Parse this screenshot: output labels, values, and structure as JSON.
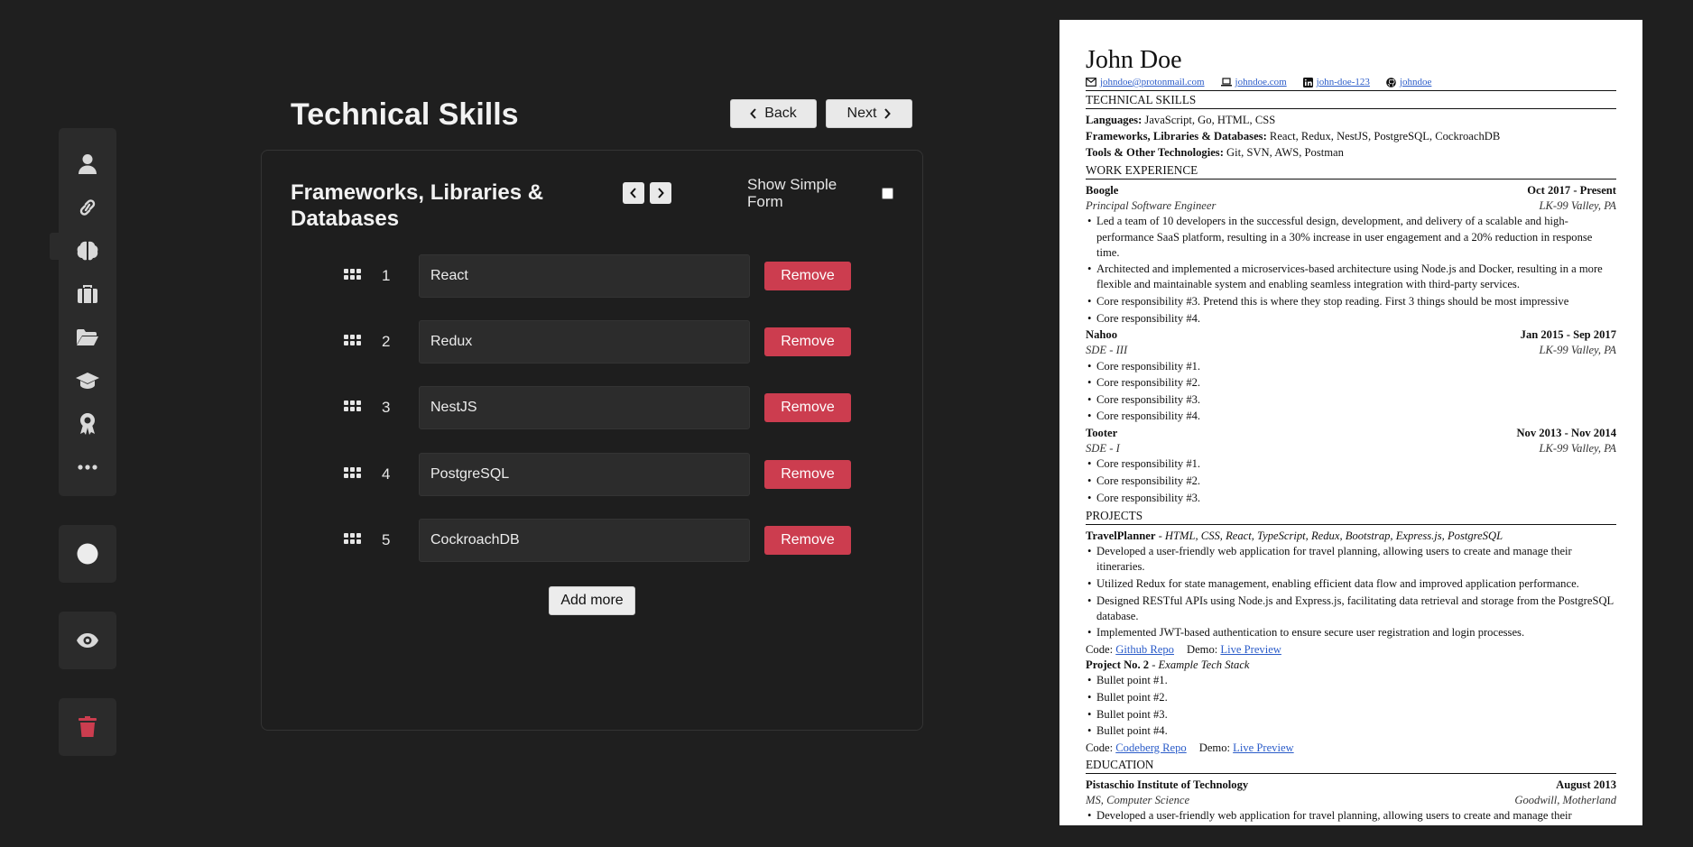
{
  "sidebar": {
    "nav_icons": [
      "user-icon",
      "link-icon",
      "brain-icon",
      "briefcase-icon",
      "folder-icon",
      "graduation-cap-icon",
      "award-icon",
      "ellipsis-icon"
    ],
    "active_index": 2,
    "extra_icons": [
      "circle-icon",
      "eye-icon",
      "trash-icon"
    ],
    "trash_color": "#cc3d4f"
  },
  "header": {
    "title": "Technical Skills",
    "back_label": "Back",
    "next_label": "Next"
  },
  "card": {
    "title": "Frameworks, Libraries & Databases",
    "show_simple_label": "Show Simple Form",
    "show_simple_checked": false,
    "items": [
      {
        "num": "1",
        "value": "React"
      },
      {
        "num": "2",
        "value": "Redux"
      },
      {
        "num": "3",
        "value": "NestJS"
      },
      {
        "num": "4",
        "value": "PostgreSQL"
      },
      {
        "num": "5",
        "value": "CockroachDB"
      }
    ],
    "remove_label": "Remove",
    "add_more_label": "Add more",
    "accent_color": "#cc3d4f"
  },
  "resume": {
    "name": "John Doe",
    "contacts": [
      {
        "icon": "mail-icon",
        "text": "johndoe@protonmail.com"
      },
      {
        "icon": "laptop-icon",
        "text": "johndoe.com"
      },
      {
        "icon": "linkedin-icon",
        "text": "john-doe-123"
      },
      {
        "icon": "github-icon",
        "text": "johndoe"
      }
    ],
    "skills_heading": "TECHNICAL SKILLS",
    "skills": [
      {
        "label": "Languages:",
        "value": " JavaScript, Go, HTML, CSS"
      },
      {
        "label": "Frameworks, Libraries & Databases:",
        "value": " React, Redux, NestJS, PostgreSQL, CockroachDB"
      },
      {
        "label": "Tools & Other Technologies:",
        "value": " Git, SVN, AWS, Postman"
      }
    ],
    "work_heading": "WORK EXPERIENCE",
    "work": [
      {
        "company": "Boogle",
        "dates": "Oct 2017 - Present",
        "role": "Principal Software Engineer",
        "location": "LK-99 Valley, PA",
        "bullets": [
          "Led a team of 10 developers in the successful design, development, and delivery of a scalable and high-performance SaaS platform, resulting in a 30% increase in user engagement and a 20% reduction in response time.",
          "Architected and implemented a microservices-based architecture using Node.js and Docker, resulting in a more flexible and maintainable system and enabling seamless integration with third-party services.",
          "Core responsibility #3. Pretend this is where they stop reading. First 3 things should be most impressive",
          "Core responsibility #4."
        ]
      },
      {
        "company": "Nahoo",
        "dates": "Jan 2015 - Sep 2017",
        "role": "SDE - III",
        "location": "LK-99 Valley, PA",
        "bullets": [
          "Core responsibility #1.",
          "Core responsibility #2.",
          "Core responsibility #3.",
          "Core responsibility #4."
        ]
      },
      {
        "company": "Tooter",
        "dates": "Nov 2013 - Nov 2014",
        "role": "SDE - I",
        "location": "LK-99 Valley, PA",
        "bullets": [
          "Core responsibility #1.",
          "Core responsibility #2.",
          "Core responsibility #3."
        ]
      }
    ],
    "projects_heading": "PROJECTS",
    "projects": [
      {
        "name": "TravelPlanner",
        "stack": " - HTML, CSS, React, TypeScript, Redux, Bootstrap, Express.js, PostgreSQL",
        "bullets": [
          "Developed a user-friendly web application for travel planning, allowing users to create and manage their itineraries.",
          "Utilized Redux for state management, enabling efficient data flow and improved application performance.",
          "Designed RESTful APIs using Node.js and Express.js, facilitating data retrieval and storage from the PostgreSQL database.",
          "Implemented JWT-based authentication to ensure secure user registration and login processes."
        ],
        "code_label": "Code:",
        "code_link": "Github Repo",
        "demo_label": "Demo:",
        "demo_link": "Live Preview"
      },
      {
        "name": "Project No. 2",
        "stack": " - Example Tech Stack",
        "bullets": [
          "Bullet point #1.",
          "Bullet point #2.",
          "Bullet point #3.",
          "Bullet point #4."
        ],
        "code_label": "Code:",
        "code_link": "Codeberg Repo",
        "demo_label": "Demo:",
        "demo_link": "Live Preview"
      }
    ],
    "education_heading": "EDUCATION",
    "education": [
      {
        "school": "Pistaschio Institute of Technology",
        "dates": "August 2013",
        "degree": "MS, Computer Science",
        "location": "Goodwill, Motherland",
        "bullets": [
          "Developed a user-friendly web application for travel planning, allowing users to create and manage their itineraries."
        ]
      }
    ],
    "link_color": "#2b5cc9"
  }
}
